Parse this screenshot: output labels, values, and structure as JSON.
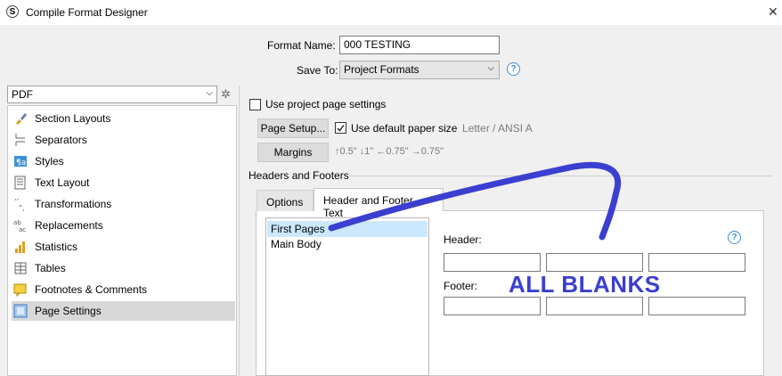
{
  "window": {
    "title": "Compile Format Designer",
    "app_icon_glyph": "S",
    "close_glyph": "✕"
  },
  "form": {
    "format_name_label": "Format Name:",
    "format_name_value": "000 TESTING",
    "save_to_label": "Save To:",
    "save_to_value": "Project Formats"
  },
  "sidebar": {
    "output_format": "PDF",
    "items": [
      {
        "label": "Section Layouts",
        "icon": "brush-icon"
      },
      {
        "label": "Separators",
        "icon": "separator-icon"
      },
      {
        "label": "Styles",
        "icon": "styles-icon"
      },
      {
        "label": "Text Layout",
        "icon": "text-layout-icon"
      },
      {
        "label": "Transformations",
        "icon": "transform-icon"
      },
      {
        "label": "Replacements",
        "icon": "replace-icon"
      },
      {
        "label": "Statistics",
        "icon": "stats-icon"
      },
      {
        "label": "Tables",
        "icon": "table-icon"
      },
      {
        "label": "Footnotes & Comments",
        "icon": "footnote-icon"
      },
      {
        "label": "Page Settings",
        "icon": "page-settings-icon",
        "selected": true
      }
    ]
  },
  "page_settings": {
    "use_project_label": "Use project page settings",
    "page_setup_label": "Page Setup...",
    "use_default_label": "Use default paper size",
    "paper_size": "Letter / ANSI A",
    "margins_label": "Margins",
    "margins_value": "↑0.5\" ↓1\" ←0.75\" →0.75\"",
    "section_title": "Headers and Footers",
    "tabs": [
      "Options",
      "Header and Footer Text"
    ],
    "pages": [
      "First Pages",
      "Main Body"
    ],
    "header_label": "Header:",
    "footer_label": "Footer:"
  },
  "annotation": {
    "text": "ALL BLANKS",
    "color": "#3b3fd0"
  },
  "colors": {
    "accent": "#3c8fd6",
    "selection": "#cce8ff"
  }
}
